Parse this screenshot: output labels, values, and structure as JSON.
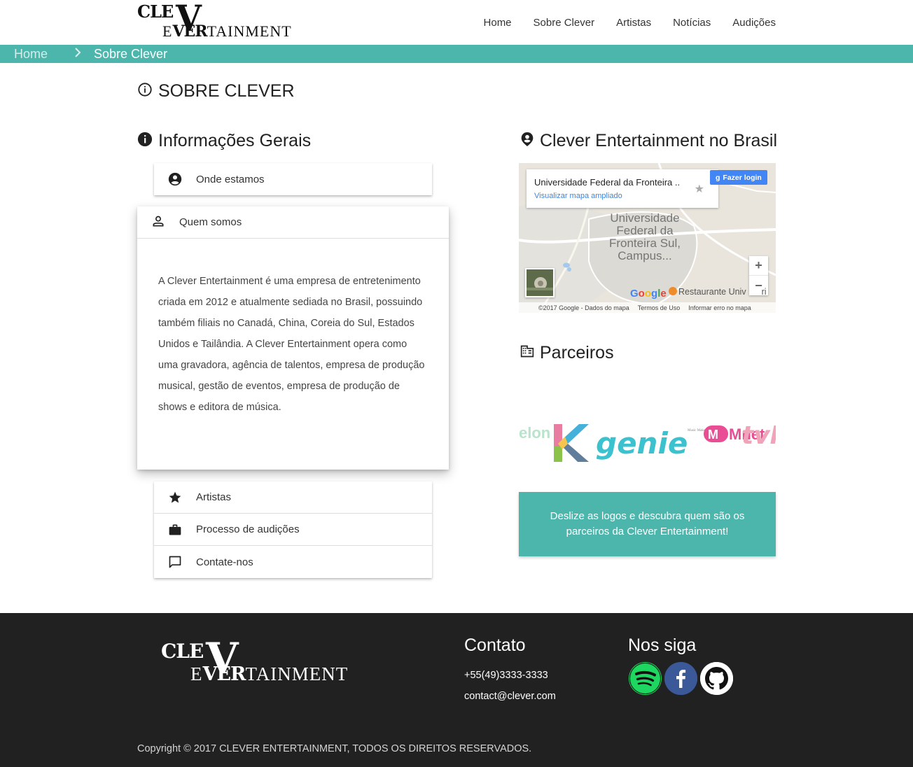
{
  "brand": {
    "line1": "CLE",
    "bigN": "V",
    "line2_prefix": "E",
    "line2_bold": "VER",
    "line2_rest": "TAINMENT"
  },
  "nav": {
    "items": [
      "Home",
      "Sobre Clever",
      "Artistas",
      "Notícias",
      "Audições"
    ]
  },
  "breadcrumb": {
    "home": "Home",
    "separator": ">",
    "current": "Sobre Clever"
  },
  "page": {
    "title": "SOBRE CLEVER"
  },
  "info": {
    "heading": "Informações Gerais",
    "items": [
      {
        "label": "Onde estamos",
        "icon": "account-circle-icon"
      },
      {
        "label": "Quem somos",
        "icon": "person-outline-icon"
      },
      {
        "label": "Artistas",
        "icon": "star-icon"
      },
      {
        "label": "Processo de audições",
        "icon": "briefcase-icon"
      },
      {
        "label": "Contate-nos",
        "icon": "chat-bubble-icon"
      }
    ],
    "quem_somos_text": "A Clever Entertainment é uma empresa de entretenimento criada em 2012 e atualmente sediada no Brasil, possuindo também filiais no Canadá, China, Coreia do Sul, Estados Unidos e Tailândia. A Clever Entertainment opera como uma gravadora, agência de talentos, empresa de produção musical, gestão de eventos, empresa de produção de shows e editora de música."
  },
  "brasil": {
    "heading": "Clever Entertainment no Brasil",
    "map": {
      "place_title": "Universidade Federal da Fronteira ..",
      "view_larger": "Visualizar mapa ampliado",
      "login": "Fazer login",
      "place_label": "Universidade Federal da Fronteira Sul, Campus...",
      "zoom_in": "+",
      "zoom_out": "−",
      "google": "Google",
      "restaurant": "Restaurante Univ",
      "restaurant_tail": "ri",
      "footer": [
        "©2017 Google - Dados do mapa",
        "Termos de Uso",
        "Informar erro no mapa"
      ]
    }
  },
  "partners": {
    "heading": "Parceiros",
    "logos": [
      "elon",
      "genie",
      "Music Makes ONE",
      "Mnet",
      "tvN"
    ],
    "cta": "Deslize as logos e descubra quem são os parceiros da Clever Entertainment!"
  },
  "footer": {
    "contact_heading": "Contato",
    "phone": "+55(49)3333-3333",
    "email": "contact@clever.com",
    "follow_heading": "Nos siga",
    "social": [
      "spotify-icon",
      "facebook-icon",
      "github-icon"
    ],
    "copyright": "Copyright © 2017 CLEVER ENTERTAINMENT, TODOS OS DIREITOS RESERVADOS."
  },
  "colors": {
    "accent": "#4db6ac",
    "footer_bg": "#212121",
    "spotify": "#1ed760",
    "facebook": "#3b5998"
  }
}
